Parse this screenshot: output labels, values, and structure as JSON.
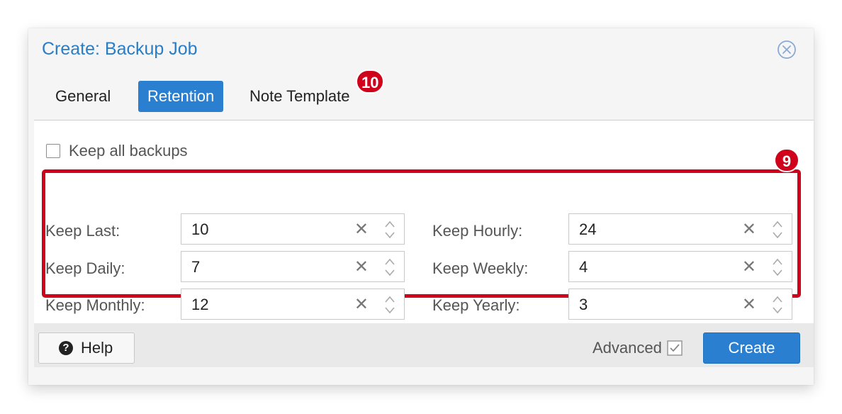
{
  "dialog": {
    "title": "Create: Backup Job",
    "tabs": [
      {
        "label": "General",
        "active": false
      },
      {
        "label": "Retention",
        "active": true
      },
      {
        "label": "Note Template",
        "active": false
      }
    ],
    "badges": {
      "tab_badge": "10",
      "fields_badge": "9"
    },
    "keep_all": {
      "label": "Keep all backups",
      "checked": false
    },
    "retention": {
      "left": [
        {
          "label": "Keep Last:",
          "value": "10"
        },
        {
          "label": "Keep Daily:",
          "value": "7"
        },
        {
          "label": "Keep Monthly:",
          "value": "12"
        }
      ],
      "right": [
        {
          "label": "Keep Hourly:",
          "value": "24"
        },
        {
          "label": "Keep Weekly:",
          "value": "4"
        },
        {
          "label": "Keep Yearly:",
          "value": "3"
        }
      ],
      "clear_glyph": "✕"
    },
    "footer": {
      "help_label": "Help",
      "advanced_label": "Advanced",
      "advanced_checked": true,
      "create_label": "Create"
    }
  },
  "colors": {
    "accent": "#2a7fd0",
    "title": "#2a7dc7",
    "highlight": "#d0021b"
  },
  "icons": [
    "close-icon",
    "help-icon",
    "checkbox-icon",
    "spinner-icon"
  ]
}
